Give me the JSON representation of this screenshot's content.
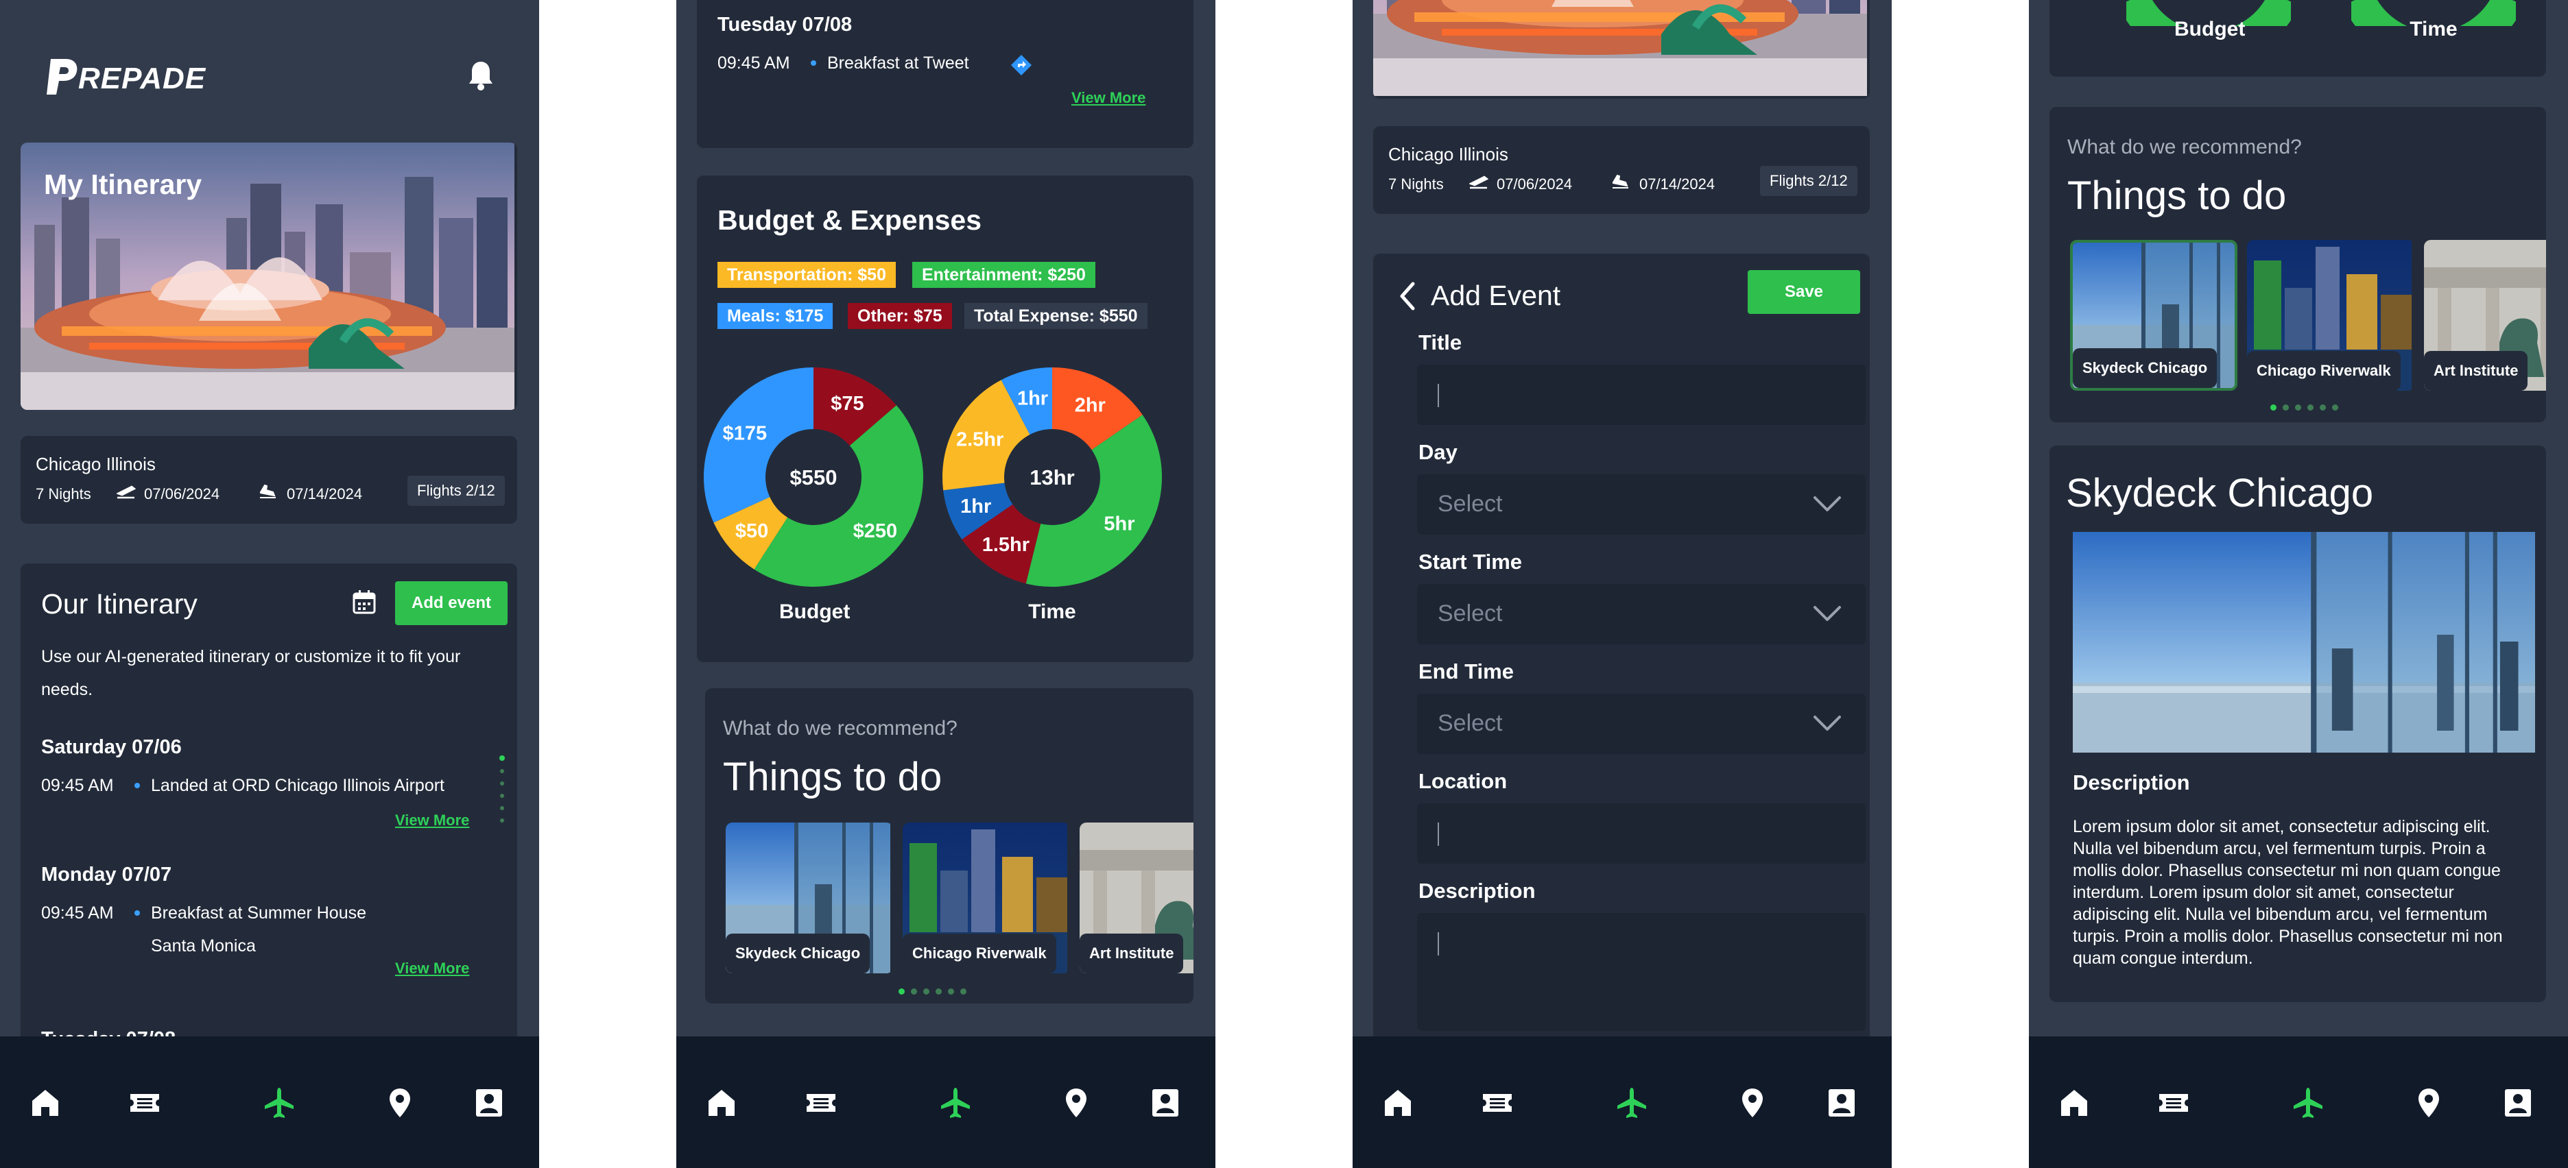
{
  "brand": {
    "name": "REPADE"
  },
  "colors": {
    "bg": "#323b4b",
    "card": "#232b3a",
    "nav": "#111a28",
    "accent": "#2ed158",
    "blue": "#2f96ff",
    "yellow": "#fbb925",
    "red": "#950d1d",
    "orange": "#ff5722"
  },
  "nav": {
    "icons": [
      "home-icon",
      "ticket-icon",
      "plane-icon",
      "location-pin-icon",
      "profile-card-icon"
    ],
    "active": "plane-icon"
  },
  "trip": {
    "city": "Chicago Illinois",
    "nights": "7 Nights",
    "depart": "07/06/2024",
    "return": "07/14/2024",
    "flights": "Flights 2/12"
  },
  "hero": {
    "title": "My Itinerary"
  },
  "itinerary": {
    "title": "Our Itinerary",
    "add_label": "Add event",
    "intro": "Use our AI-generated itinerary or customize it to fit your needs.",
    "days": [
      {
        "day": "Saturday 07/06",
        "time": "09:45 AM",
        "event": "Landed at ORD Chicago Illinois Airport",
        "more": "View More"
      },
      {
        "day": "Monday 07/07",
        "time": "09:45 AM",
        "event": "Breakfast at Summer House",
        "event2": "Santa Monica",
        "more": "View More"
      },
      {
        "day": "Tuesday 07/08",
        "time": "09:45 AM",
        "event": "Breakfast at Tweet",
        "more": "View More"
      }
    ]
  },
  "budget": {
    "title": "Budget & Expenses",
    "tags": {
      "transport": "Transportation: $50",
      "entertain": "Entertainment: $250",
      "meals": "Meals: $175",
      "other": "Other: $75",
      "total": "Total Expense: $550"
    }
  },
  "chart_data": [
    {
      "type": "pie",
      "title": "Budget",
      "center_label": "$550",
      "categories": [
        "Other",
        "Entertainment",
        "Transportation",
        "Meals"
      ],
      "values": [
        75,
        250,
        50,
        175
      ],
      "labels": [
        "$75",
        "$250",
        "$50",
        "$175"
      ],
      "colors": [
        "#950d1d",
        "#2ebf4d",
        "#fbb925",
        "#2f96ff"
      ]
    },
    {
      "type": "pie",
      "title": "Time",
      "center_label": "13hr",
      "values": [
        2,
        5,
        1.5,
        1,
        2.5,
        1
      ],
      "labels": [
        "2hr",
        "5hr",
        "1.5hr",
        "1hr",
        "2.5hr",
        "1hr"
      ],
      "colors": [
        "#ff5722",
        "#2ebf4d",
        "#950d1d",
        "#1565c0",
        "#fbb925",
        "#2f96ff"
      ]
    }
  ],
  "recommend": {
    "question": "What do we recommend?",
    "title": "Things to do",
    "items": [
      "Skydeck Chicago",
      "Chicago Riverwalk",
      "Art Institute"
    ]
  },
  "add_event": {
    "title": "Add Event",
    "save": "Save",
    "title_label": "Title",
    "day_label": "Day",
    "start_label": "Start Time",
    "end_label": "End Time",
    "location_label": "Location",
    "description_label": "Description",
    "select": "Select"
  },
  "detail": {
    "title": "Skydeck Chicago",
    "desc_heading": "Description",
    "desc": "Lorem ipsum dolor sit amet, consectetur adipiscing elit. Nulla vel bibendum arcu, vel fermentum turpis. Proin a mollis dolor. Phasellus consectetur mi non quam congue interdum. Lorem ipsum dolor sit amet, consectetur adipiscing elit. Nulla vel bibendum arcu, vel fermentum turpis. Proin a mollis dolor. Phasellus consectetur mi non quam congue interdum."
  }
}
